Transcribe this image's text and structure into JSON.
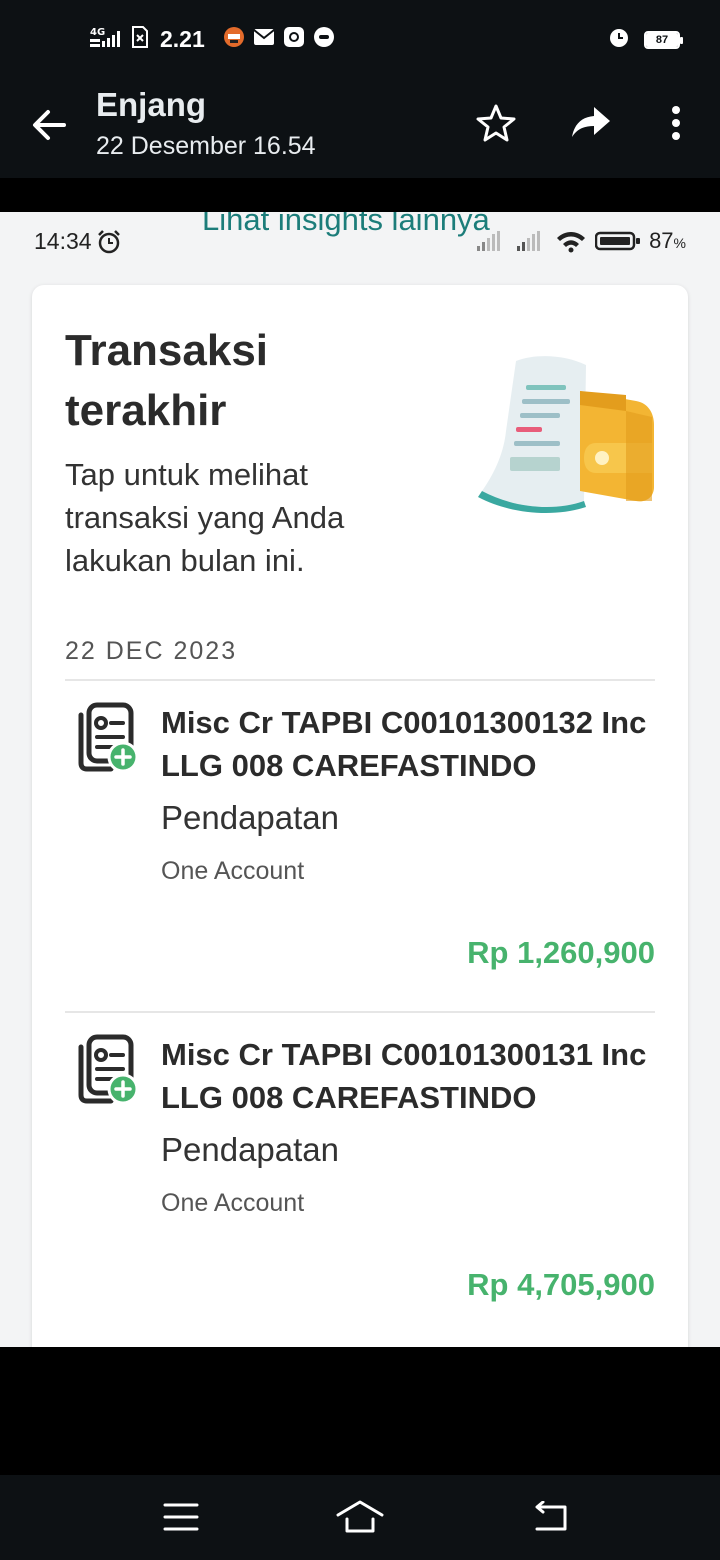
{
  "outer_status": {
    "network": "4G",
    "time": "2.21",
    "battery": "87",
    "icons": [
      "sim-icon",
      "notification-app-icon",
      "mail-icon",
      "instagram-icon",
      "message-icon",
      "alarm-icon"
    ]
  },
  "header": {
    "sender": "Enjang",
    "datetime": "22 Desember 16.54"
  },
  "inner_status": {
    "time": "14:34",
    "link_text": "Lihat insights lainnya",
    "battery": "87",
    "battery_unit": "%"
  },
  "card": {
    "title": "Transaksi terakhir",
    "description": "Tap untuk melihat transaksi yang Anda lakukan bulan ini.",
    "date_label": "22 DEC 2023",
    "transactions": [
      {
        "title": "Misc Cr TAPBI C00101300132 Inc LLG 008 CAREFASTINDO",
        "category": "Pendapatan",
        "account": "One Account",
        "amount": "Rp 1,260,900"
      },
      {
        "title": "Misc Cr TAPBI C00101300131 Inc LLG 008 CAREFASTINDO",
        "category": "Pendapatan",
        "account": "One Account",
        "amount": "Rp 4,705,900"
      }
    ]
  },
  "colors": {
    "amount_green": "#47b36d",
    "link_teal": "#1c7d7a",
    "dark_bg": "#0d1114"
  }
}
